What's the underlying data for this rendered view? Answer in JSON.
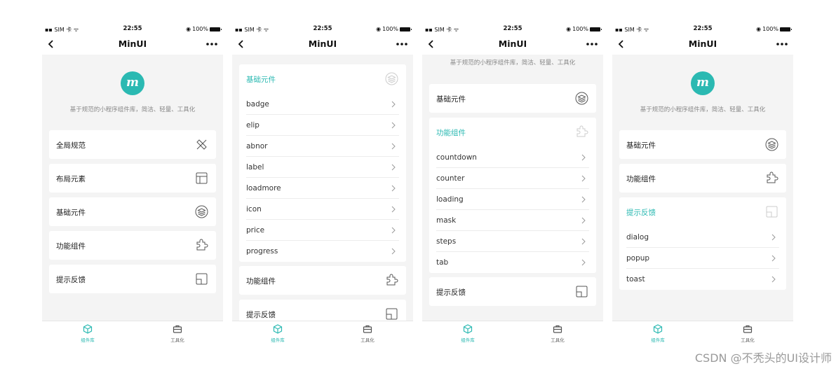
{
  "accent_color": "#2bb9b2",
  "status_bar": {
    "carrier": "SIM 卡",
    "time": "22:55",
    "battery": "100%"
  },
  "nav": {
    "title": "MinUI"
  },
  "hero": {
    "logo_text": "m",
    "description": "基于规范的小程序组件库，简洁、轻量、工具化"
  },
  "tabbar": {
    "components": "组件库",
    "tools": "工具化"
  },
  "screens": {
    "s1": {
      "menu": [
        "全局规范",
        "布局元素",
        "基础元件",
        "功能组件",
        "提示反馈"
      ]
    },
    "s2": {
      "expanded_title": "基础元件",
      "items": [
        "badge",
        "elip",
        "abnor",
        "label",
        "loadmore",
        "icon",
        "price",
        "progress"
      ],
      "after": [
        "功能组件",
        "提示反馈"
      ]
    },
    "s3": {
      "description": "基于规范的小程序组件库，简洁、轻量、工具化",
      "before": "基础元件",
      "expanded_title": "功能组件",
      "items": [
        "countdown",
        "counter",
        "loading",
        "mask",
        "steps",
        "tab"
      ],
      "after": "提示反馈"
    },
    "s4": {
      "before": [
        "基础元件",
        "功能组件"
      ],
      "expanded_title": "提示反馈",
      "items": [
        "dialog",
        "popup",
        "toast"
      ]
    }
  },
  "watermark": "CSDN @不秃头的UI设计师"
}
